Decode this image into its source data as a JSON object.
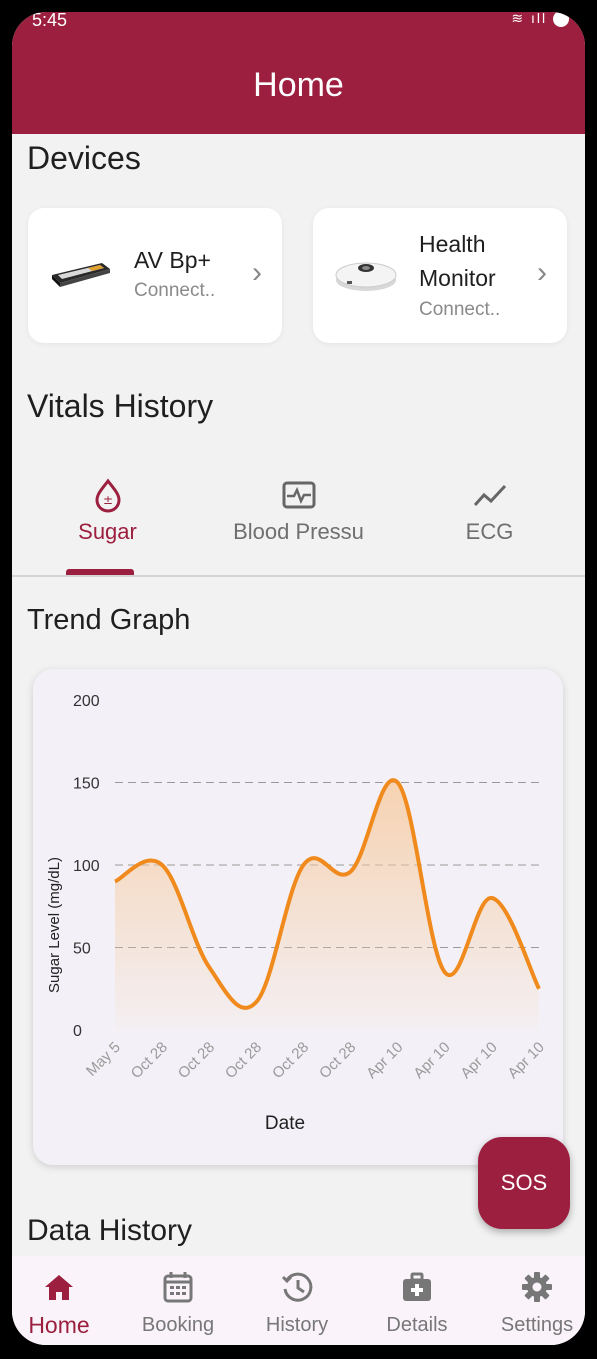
{
  "status_bar": {
    "time": "5:45",
    "icons": "wifi-signal-battery"
  },
  "header": {
    "title": "Home"
  },
  "devices": {
    "title": "Devices",
    "items": [
      {
        "name_line1": "AV Bp+",
        "name_line2": "",
        "status": "Connect..",
        "icon": "bp-monitor-image"
      },
      {
        "name_line1": "Health",
        "name_line2": "Monitor",
        "status": "Connect..",
        "icon": "health-monitor-image"
      }
    ]
  },
  "vitals": {
    "title": "Vitals History",
    "tabs": [
      {
        "label": "Sugar",
        "icon": "blood-drop-icon",
        "active": true
      },
      {
        "label": "Blood Pressu",
        "icon": "heart-monitor-icon",
        "active": false
      },
      {
        "label": "ECG",
        "icon": "trend-line-icon",
        "active": false
      }
    ]
  },
  "trend": {
    "title": "Trend Graph"
  },
  "chart_data": {
    "type": "area",
    "title": "",
    "xlabel": "Date",
    "ylabel": "Sugar Level (mg/dL)",
    "ylim": [
      0,
      200
    ],
    "yticks": [
      0,
      50,
      100,
      150,
      200
    ],
    "grid": "dashed horizontal at 50, 100, 150",
    "line_color": "#f08a1c",
    "fill_color": "#f7c89a",
    "x_ticklabels": [
      "May 5",
      "Oct 28",
      "Oct 28",
      "Oct 28",
      "Oct 28",
      "Oct 28",
      "Apr 10",
      "Apr 10",
      "Apr 10",
      "Apr 10"
    ],
    "series": [
      {
        "values": [
          90,
          100,
          38,
          17,
          100,
          96,
          150,
          35,
          80,
          25
        ]
      }
    ]
  },
  "data_history": {
    "title": "Data History"
  },
  "sos": {
    "label": "SOS"
  },
  "nav": {
    "items": [
      {
        "label": "Home",
        "icon": "home-icon",
        "active": true
      },
      {
        "label": "Booking",
        "icon": "calendar-icon",
        "active": false
      },
      {
        "label": "History",
        "icon": "history-icon",
        "active": false
      },
      {
        "label": "Details",
        "icon": "medical-kit-icon",
        "active": false
      },
      {
        "label": "Settings",
        "icon": "gear-icon",
        "active": false
      }
    ]
  },
  "colors": {
    "primary": "#9c1f3f",
    "background": "#f2f2f2",
    "chart_line": "#f08a1c"
  }
}
